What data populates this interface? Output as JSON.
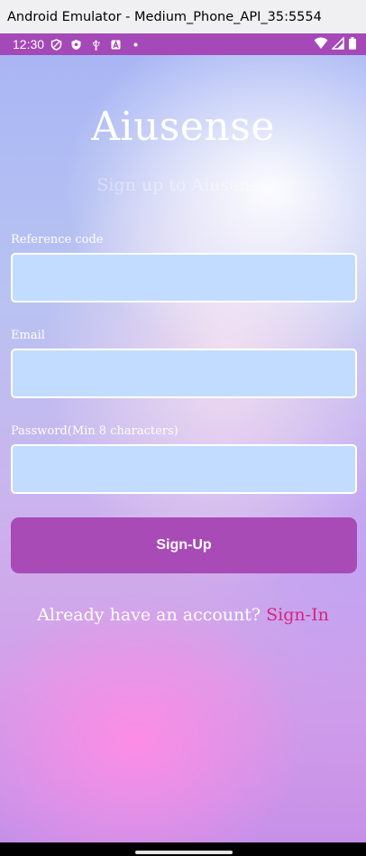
{
  "window": {
    "title": "Android Emulator - Medium_Phone_API_35:5554"
  },
  "status_bar": {
    "time": "12:30",
    "icons_left": [
      "shield-outline-icon",
      "shield-filled-icon",
      "usb-icon",
      "a-box-icon",
      "dot-icon"
    ],
    "icons_right": [
      "wifi-icon",
      "signal-icon",
      "battery-icon"
    ],
    "color": "#a548b8"
  },
  "app": {
    "title": "Aiusense",
    "subtitle": "Sign up to Aiusense"
  },
  "form": {
    "reference_code": {
      "label": "Reference code",
      "value": "",
      "placeholder": ""
    },
    "email": {
      "label": "Email",
      "value": "",
      "placeholder": ""
    },
    "password": {
      "label": "Password(Min 8 characters)",
      "value": "",
      "placeholder": ""
    }
  },
  "signup_button": {
    "label": "Sign-Up",
    "color": "#a94bb6"
  },
  "signin": {
    "prompt": "Already have an account?",
    "link": "Sign-In",
    "link_color": "#d8247f"
  }
}
